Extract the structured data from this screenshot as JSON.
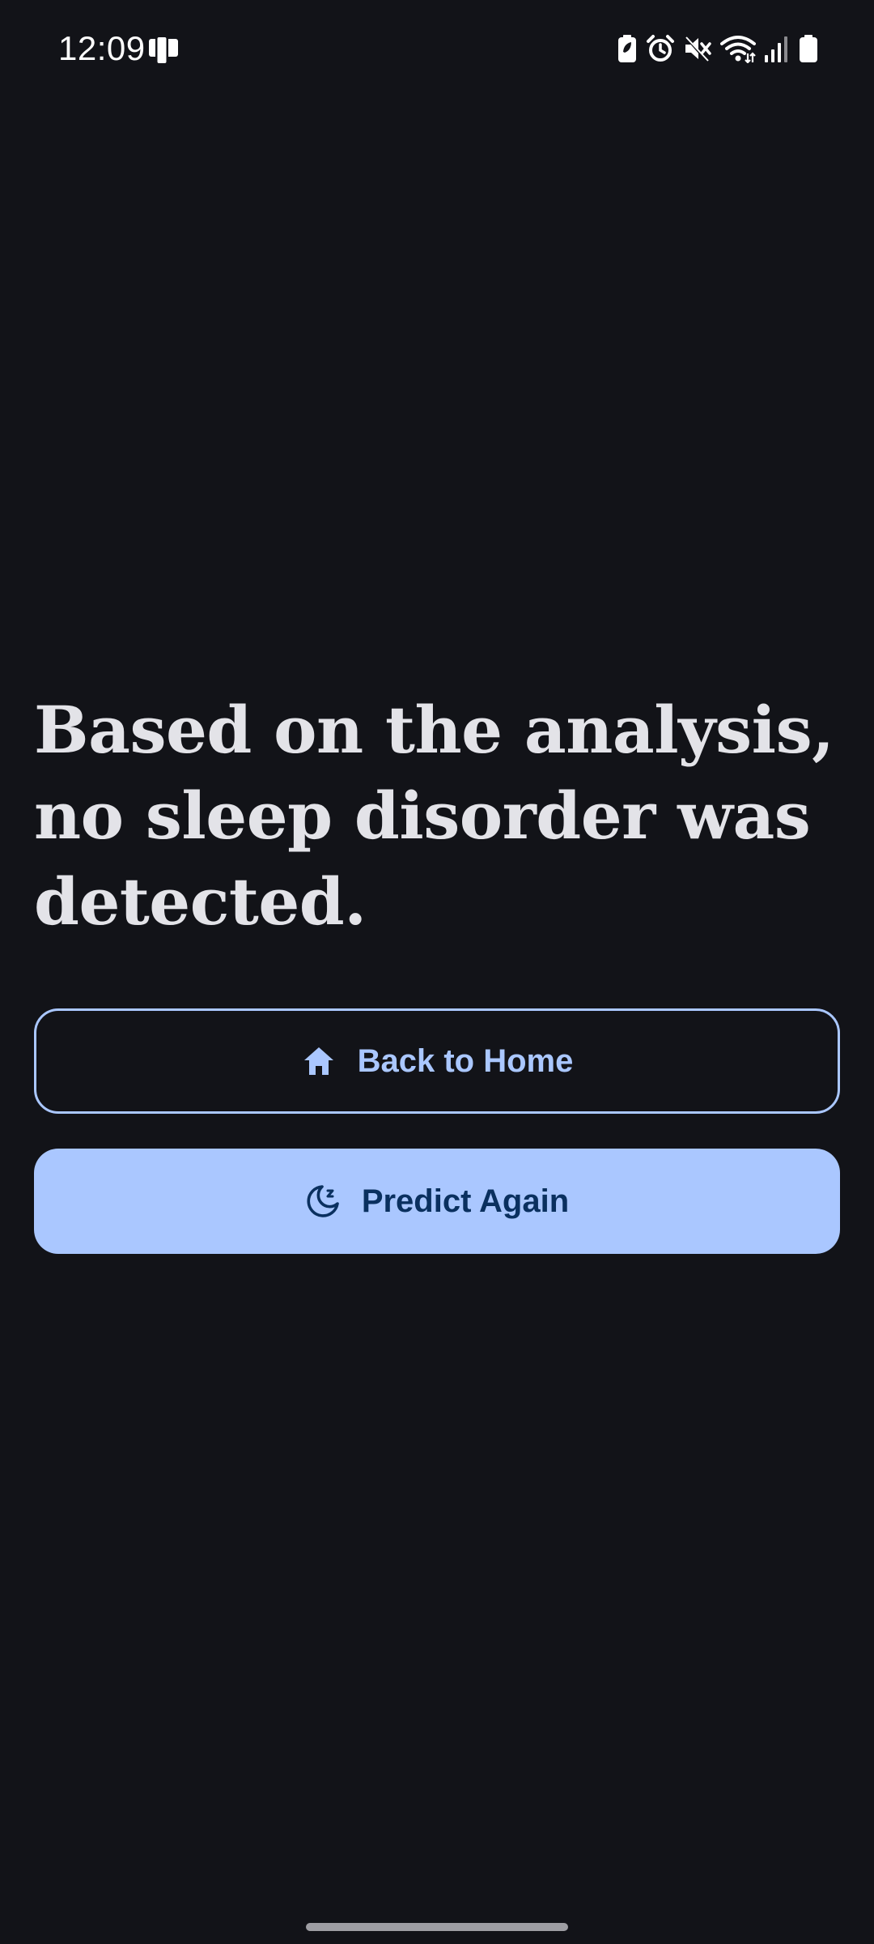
{
  "status_bar": {
    "time": "12:09",
    "left_icon": "device-transfer-icon",
    "right_icons": [
      "battery-saver-icon",
      "alarm-icon",
      "mute-icon",
      "wifi-icon",
      "signal-icon",
      "battery-icon"
    ]
  },
  "result": {
    "message": "Based on the analysis, no sleep disorder was detected."
  },
  "actions": {
    "back_home": {
      "label": "Back to Home",
      "icon": "home-icon"
    },
    "predict_again": {
      "label": "Predict Again",
      "icon": "sleep-moon-icon"
    }
  },
  "colors": {
    "background": "#121318",
    "text": "#e3e3e8",
    "primary": "#aac7ff",
    "on_primary": "#0a305f"
  }
}
